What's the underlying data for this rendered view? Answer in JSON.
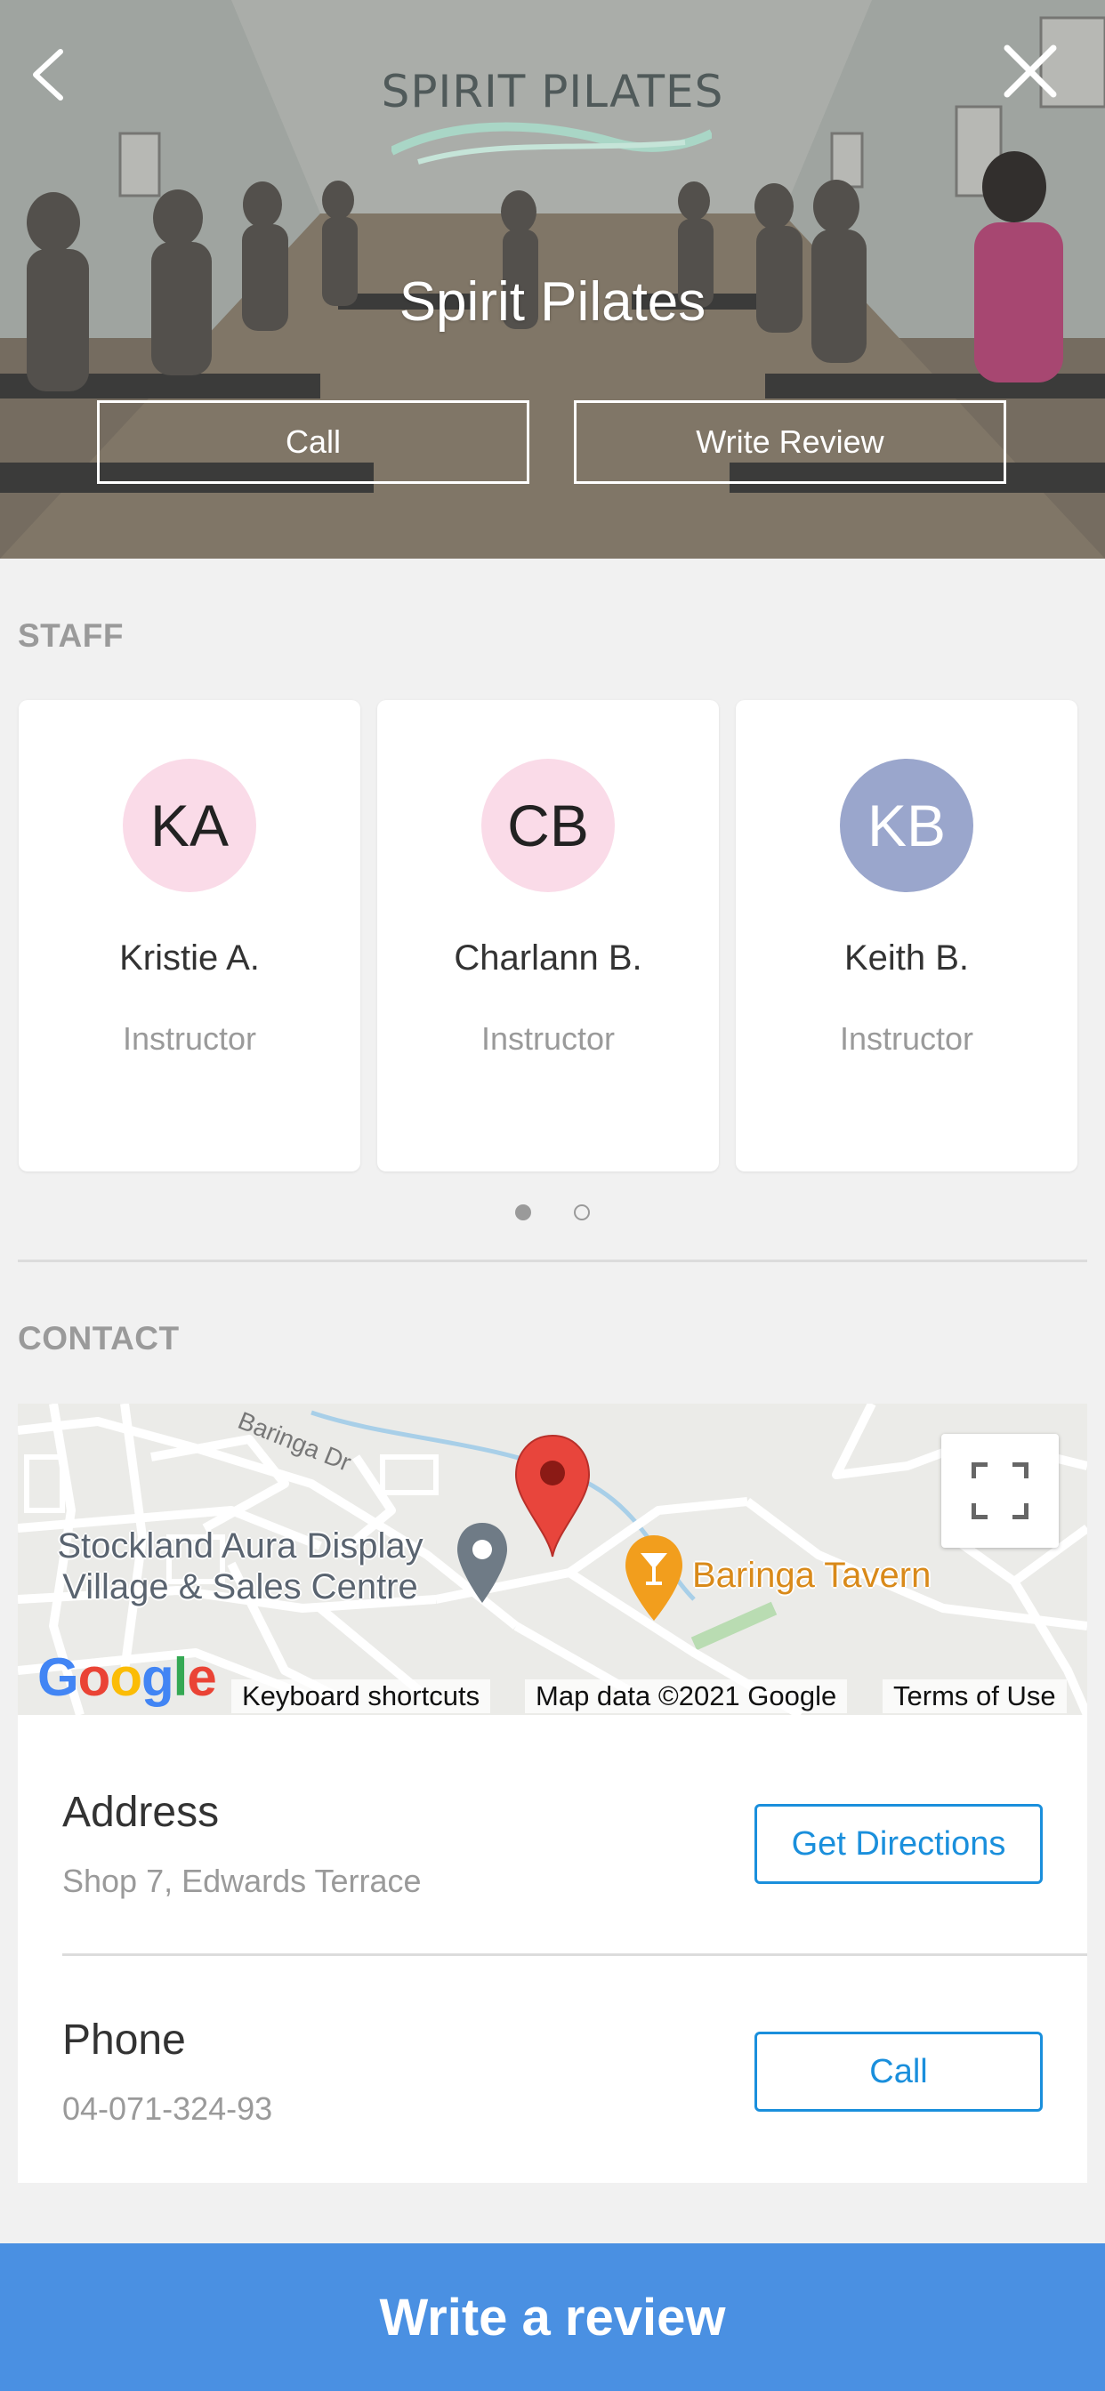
{
  "hero": {
    "brand": "SPIRIT PILATES",
    "title": "Spirit Pilates",
    "call_label": "Call",
    "review_label": "Write Review",
    "back_icon": "chevron-left-icon",
    "close_icon": "close-icon"
  },
  "staff": {
    "heading": "STAFF",
    "members": [
      {
        "initials": "KA",
        "name": "Kristie A.",
        "role": "Instructor",
        "avatar_color": "#fadbe8",
        "text_color": "#222222"
      },
      {
        "initials": "CB",
        "name": "Charlann B.",
        "role": "Instructor",
        "avatar_color": "#fadbe8",
        "text_color": "#222222"
      },
      {
        "initials": "KB",
        "name": "Keith B.",
        "role": "Instructor",
        "avatar_color": "#9aa6cc",
        "text_color": "#ffffff"
      }
    ],
    "page_count": 2,
    "active_page": 1
  },
  "contact": {
    "heading": "CONTACT",
    "map": {
      "road_label": "Baringa Dr",
      "place_1_line1": "Stockland Aura Display",
      "place_1_line2": "Village & Sales Centre",
      "place_2": "Baringa Tavern",
      "google_logo": "Google",
      "keyboard_shortcuts": "Keyboard shortcuts",
      "map_data": "Map data ©2021 Google",
      "terms": "Terms of Use"
    },
    "address_label": "Address",
    "address_value": "Shop 7, Edwards Terrace",
    "directions_label": "Get Directions",
    "phone_label": "Phone",
    "phone_value": "04-071-324-93",
    "phone_call_label": "Call"
  },
  "footer": {
    "review_label": "Write a review"
  },
  "colors": {
    "accent": "#1a8fdc",
    "bottom_bar": "#4a90e2",
    "map_pin": "#e8453c",
    "tavern_pin": "#f29e1d"
  }
}
